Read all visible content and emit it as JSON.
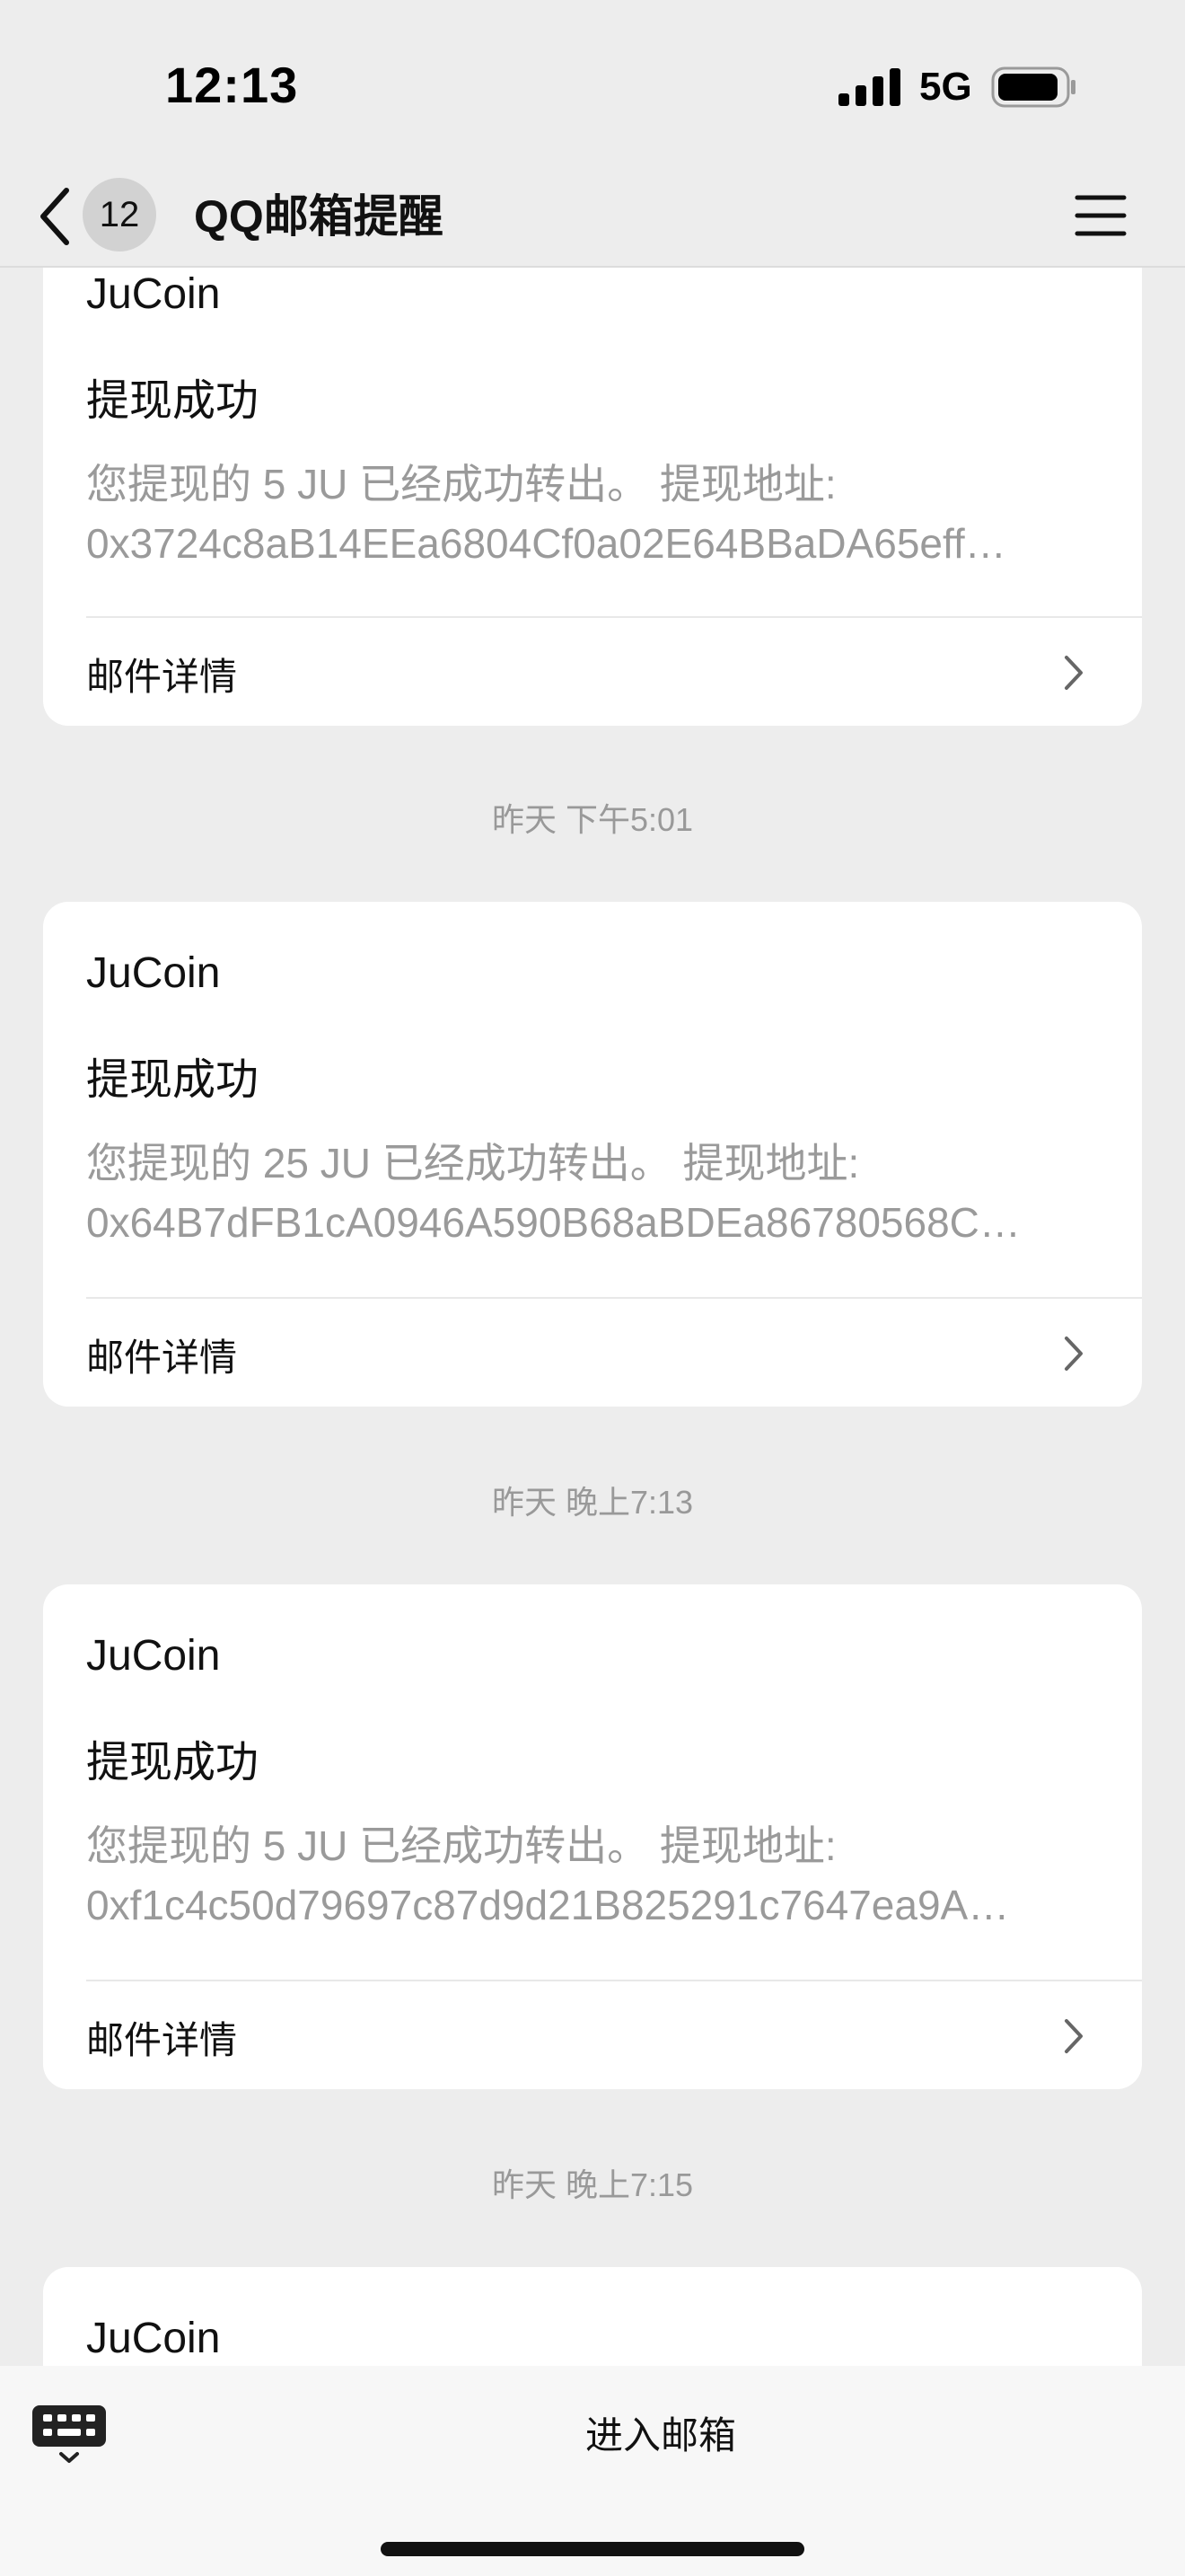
{
  "status_bar": {
    "time": "12:13",
    "network": "5G",
    "signal_icon": "cellular-signal-icon",
    "battery_icon": "battery-icon"
  },
  "nav": {
    "back_icon": "chevron-left-icon",
    "badge_count": "12",
    "title": "QQ邮箱提醒",
    "menu_icon": "hamburger-menu-icon"
  },
  "messages": [
    {
      "sender": "JuCoin",
      "subject": "提现成功",
      "preview_line1": "您提现的 5 JU 已经成功转出。 提现地址:",
      "preview_line2": "0x3724c8aB14EEa6804Cf0a02E64BBaDA65eff…",
      "detail_label": "邮件详情"
    },
    {
      "timestamp": "昨天 下午5:01",
      "sender": "JuCoin",
      "subject": "提现成功",
      "preview_line1": "您提现的 25 JU 已经成功转出。 提现地址:",
      "preview_line2": "0x64B7dFB1cA0946A590B68aBDEa86780568C…",
      "detail_label": "邮件详情"
    },
    {
      "timestamp": "昨天 晚上7:13",
      "sender": "JuCoin",
      "subject": "提现成功",
      "preview_line1": "您提现的 5 JU 已经成功转出。 提现地址:",
      "preview_line2": "0xf1c4c50d79697c87d9d21B825291c7647ea9A…",
      "detail_label": "邮件详情"
    },
    {
      "timestamp": "昨天 晚上7:15",
      "sender": "JuCoin"
    }
  ],
  "bottom_bar": {
    "keyboard_icon": "keyboard-icon",
    "enter_mailbox_label": "进入邮箱"
  }
}
